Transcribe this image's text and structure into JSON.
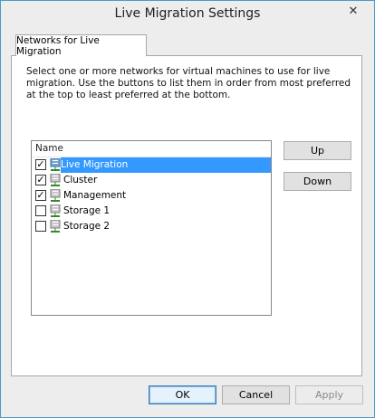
{
  "window": {
    "title": "Live Migration Settings"
  },
  "tab": {
    "label": "Networks for Live Migration"
  },
  "description": "Select one or more networks for virtual machines to use for live migration. Use the buttons to list them in order from most preferred at the top to least preferred at the bottom.",
  "list": {
    "header": "Name",
    "items": [
      {
        "label": "Live Migration",
        "checked": true,
        "selected": true
      },
      {
        "label": "Cluster",
        "checked": true,
        "selected": false
      },
      {
        "label": "Management",
        "checked": true,
        "selected": false
      },
      {
        "label": "Storage 1",
        "checked": false,
        "selected": false
      },
      {
        "label": "Storage 2",
        "checked": false,
        "selected": false
      }
    ]
  },
  "buttons": {
    "up": "Up",
    "down": "Down",
    "ok": "OK",
    "cancel": "Cancel",
    "apply": "Apply"
  },
  "icons": {
    "close": "close-icon",
    "network": "network-icon"
  },
  "colors": {
    "selection": "#3399ff",
    "window_border": "#4a9cc7"
  }
}
